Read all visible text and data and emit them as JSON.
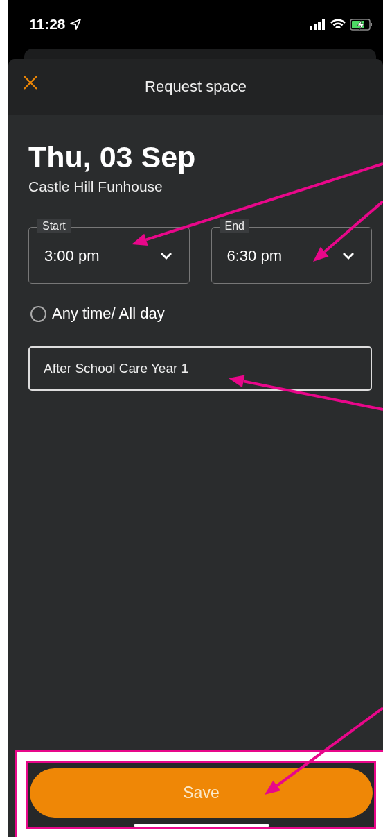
{
  "status_bar": {
    "time": "11:28"
  },
  "header": {
    "title": "Request space"
  },
  "date_title": "Thu, 03 Sep",
  "location": "Castle Hill Funhouse",
  "time_fields": [
    {
      "label": "Start",
      "value": "3:00 pm"
    },
    {
      "label": "End",
      "value": "6:30 pm"
    }
  ],
  "all_day": {
    "label": "Any time/ All day",
    "selected": false
  },
  "note_field": {
    "value": "After School Care Year 1"
  },
  "save_button": {
    "label": "Save"
  }
}
